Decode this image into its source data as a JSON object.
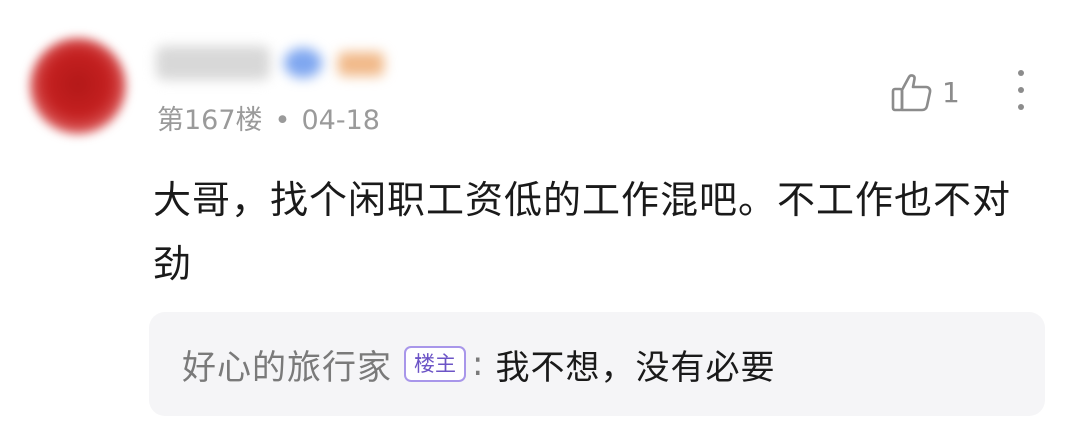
{
  "comment": {
    "floor_label": "第167楼",
    "separator": "•",
    "date": "04-18",
    "like_count": "1",
    "text": "大哥，找个闲职工资低的工作混吧。不工作也不对劲",
    "icons": {
      "like": "thumbs-up-icon",
      "more": "more-vertical-icon"
    }
  },
  "reply": {
    "author": "好心的旅行家",
    "author_badge": "楼主",
    "colon": ":",
    "text": "我不想，没有必要"
  },
  "colors": {
    "text_primary": "#1a1a1a",
    "text_secondary": "#9a9a9a",
    "reply_bg": "#f5f5f7",
    "op_badge": "#6c54c6"
  }
}
